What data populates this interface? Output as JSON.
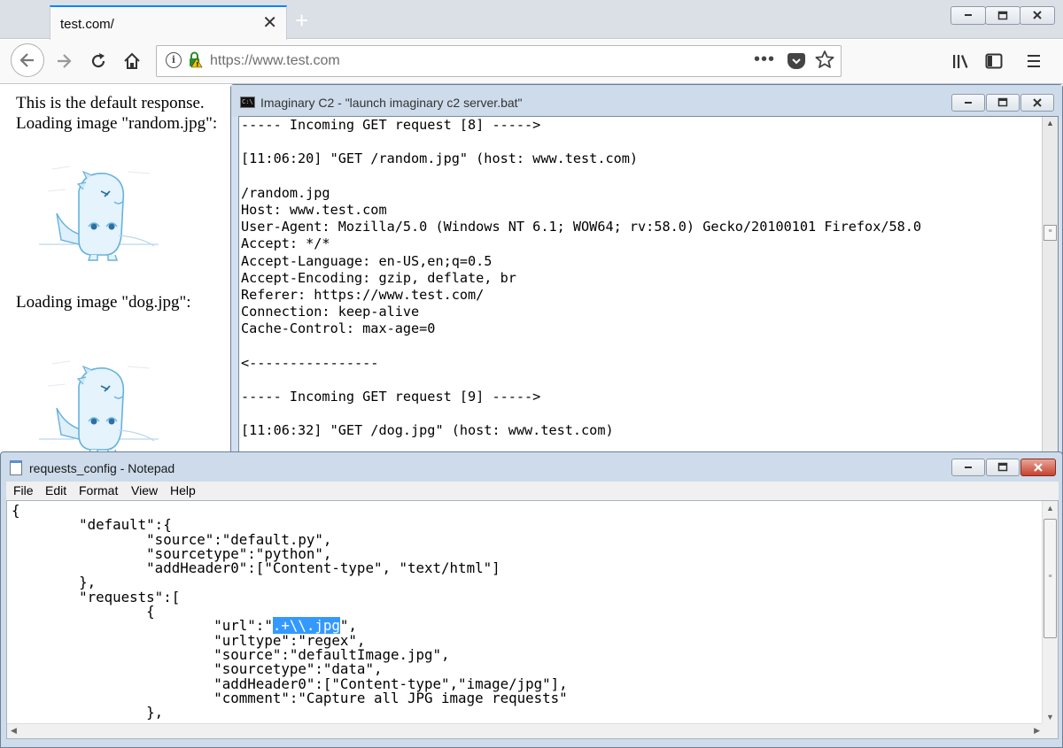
{
  "browser": {
    "tab_title": "test.com/",
    "tab_close": "✕",
    "new_tab": "+",
    "url": "https://www.test.com",
    "url_info": "i",
    "url_more": "•••",
    "window_controls": {
      "minimize": "▬",
      "maximize": "▢",
      "close": "✕"
    }
  },
  "page": {
    "line1": "This is the default response.",
    "line2": "Loading image \"random.jpg\":",
    "line3": "Loading image \"dog.jpg\":"
  },
  "console": {
    "title": "Imaginary C2 - \"launch imaginary c2 server.bat\"",
    "icon_text": "C:\\",
    "lines": [
      "----- Incoming GET request [8] ----->",
      "",
      "[11:06:20] \"GET /random.jpg\" (host: www.test.com)",
      "",
      "/random.jpg",
      "Host: www.test.com",
      "User-Agent: Mozilla/5.0 (Windows NT 6.1; WOW64; rv:58.0) Gecko/20100101 Firefox/58.0",
      "Accept: */*",
      "Accept-Language: en-US,en;q=0.5",
      "Accept-Encoding: gzip, deflate, br",
      "Referer: https://www.test.com/",
      "Connection: keep-alive",
      "Cache-Control: max-age=0",
      "",
      "<----------------",
      "",
      "----- Incoming GET request [9] ----->",
      "",
      "[11:06:32] \"GET /dog.jpg\" (host: www.test.com)"
    ]
  },
  "notepad": {
    "title": "requests_config - Notepad",
    "menu": [
      "File",
      "Edit",
      "Format",
      "View",
      "Help"
    ],
    "lines": [
      "{",
      "        \"default\":{",
      "                \"source\":\"default.py\",",
      "                \"sourcetype\":\"python\",",
      "                \"addHeader0\":[\"Content-type\", \"text/html\"]",
      "        },",
      "        \"requests\":[",
      "                {",
      "                        \"url\":\"",
      "                        \"urltype\":\"regex\",",
      "                        \"source\":\"defaultImage.jpg\",",
      "                        \"sourcetype\":\"data\",",
      "                        \"addHeader0\":[\"Content-type\",\"image/jpg\"],",
      "                        \"comment\":\"Capture all JPG image requests\"",
      "                },"
    ],
    "selected_text": ".+\\\\.jpg",
    "after_selection": "\","
  },
  "colors": {
    "selection": "#3399ff",
    "tab_accent": "#0a84ff",
    "window_frame": "#cddbeb",
    "close_button": "#c6432e"
  }
}
